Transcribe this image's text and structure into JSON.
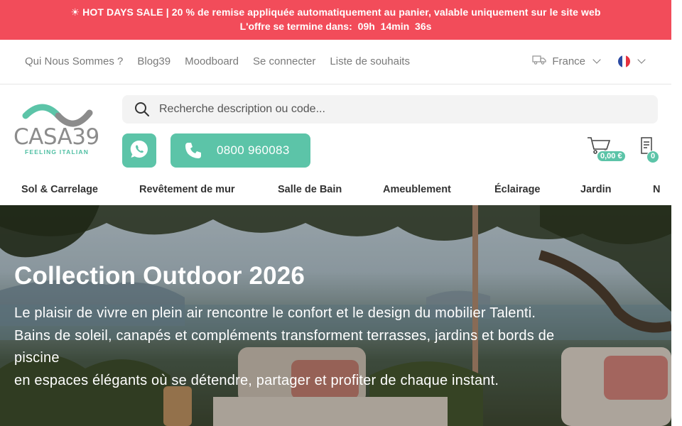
{
  "promo": {
    "line1": "☀ HOT DAYS SALE | 20 % de remise appliquée automatiquement au panier, valable uniquement sur le site web",
    "countdown_label": "L'offre se termine dans:",
    "hours": "09h",
    "minutes": "14min",
    "seconds": "36s",
    "bg_color": "#f24c5a"
  },
  "utility_nav": {
    "links": [
      "Qui Nous Sommes ?",
      "Blog39",
      "Moodboard",
      "Se connecter",
      "Liste de souhaits"
    ],
    "country": "France",
    "country_icon": "truck-icon",
    "language_flag": "france-flag-icon"
  },
  "header": {
    "logo_text": "CASA39",
    "logo_tagline": "FEELING ITALIAN",
    "search_placeholder": "Recherche description ou code...",
    "phone_number": "0800 960083",
    "cart_total": "0,00 €",
    "list_count": "0",
    "accent_color": "#5cc4a8"
  },
  "categories": [
    "Sol & Carrelage",
    "Revêtement de mur",
    "Salle de Bain",
    "Ameublement",
    "Éclairage",
    "Jardin",
    "N"
  ],
  "hero": {
    "title": "Collection Outdoor 2026",
    "lines": [
      "Le plaisir de vivre en plein air rencontre le confort et le design du mobilier Talenti.",
      "Bains de soleil, canapés et compléments transforment terrasses, jardins et bords de",
      "piscine",
      "en espaces élégants où se détendre, partager et profiter de chaque instant."
    ]
  }
}
